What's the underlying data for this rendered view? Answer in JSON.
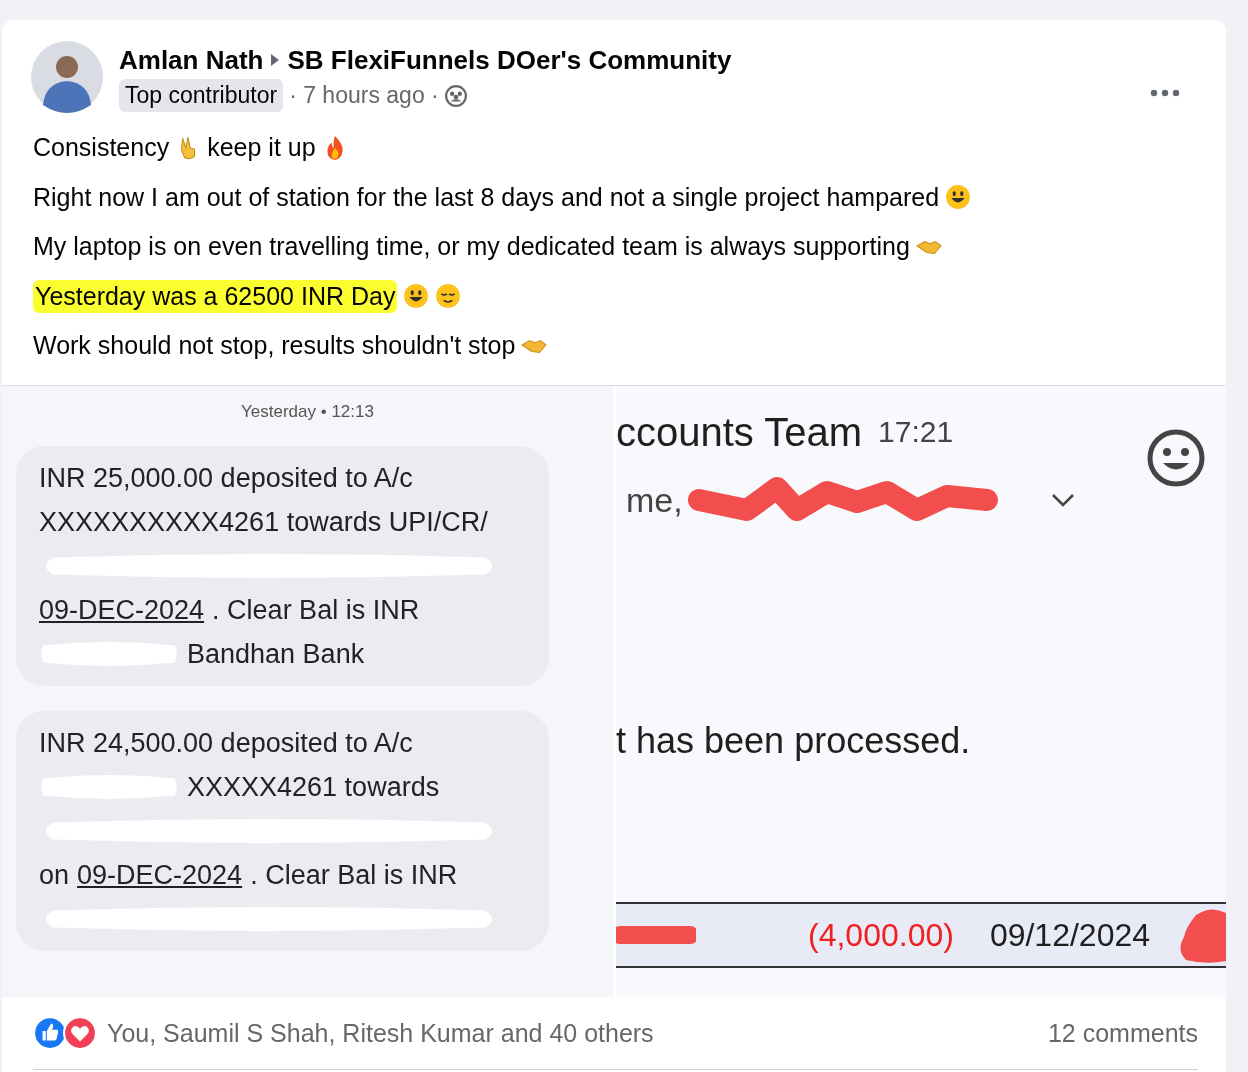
{
  "post": {
    "author": "Amlan Nath",
    "group": "SB FlexiFunnels DOer's Community",
    "badge": "Top contributor",
    "time": "· 7 hours ago ·"
  },
  "lines": [
    {
      "segments": [
        "Consistency",
        "keep it up"
      ],
      "highlighted": false
    },
    {
      "segments": [
        "Right now I am out of station for the last 8 days and not a single project hampared"
      ],
      "highlighted": false
    },
    {
      "segments": [
        "My laptop is on even travelling time, or my dedicated team is always supporting"
      ],
      "highlighted": false
    },
    {
      "segments": [
        "Yesterday was a 62500 INR Day"
      ],
      "highlighted": true
    },
    {
      "segments": [
        "Work should not stop, results shouldn't stop"
      ],
      "highlighted": false
    }
  ],
  "sms": {
    "timestamp": "Yesterday • 12:13",
    "messages": [
      {
        "lines": [
          {
            "text": "INR 25,000.00 deposited to A/c",
            "redacted": false
          },
          {
            "text": "XXXXXXXXXX4261 towards UPI/CR/",
            "redacted": false
          },
          {
            "redacted": true
          },
          {
            "date": "09-DEC-2024",
            "text": ". Clear Bal is INR",
            "redacted": false
          },
          {
            "text": "Bandhan Bank",
            "redacted": true
          }
        ]
      },
      {
        "lines": [
          {
            "text": "INR 24,500.00 deposited to A/c",
            "redacted": false
          },
          {
            "text": "XXXXX4261 towards",
            "redacted": true
          },
          {
            "redacted": true
          },
          {
            "prefix": "on",
            "date": "09-DEC-2024",
            "text": ". Clear Bal is INR",
            "redacted": false
          },
          {
            "redacted": true
          }
        ]
      }
    ]
  },
  "email": {
    "sender": "ccounts Team",
    "time": "17:21",
    "recipients": "me,",
    "body": "t has been processed.",
    "amount": "(4,000.00)",
    "date": "09/12/2024"
  },
  "footer": {
    "reactions": "You, Saumil S Shah, Ritesh Kumar and 40 others",
    "comments": "12 comments"
  }
}
